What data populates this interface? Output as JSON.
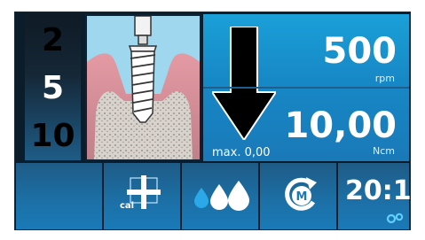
{
  "programs": {
    "items": [
      "2",
      "5",
      "10"
    ],
    "selected": "5"
  },
  "speed": {
    "value": "500",
    "unit": "rpm"
  },
  "torque": {
    "value": "10,00",
    "unit": "Ncm",
    "max_label": "max. 0,00"
  },
  "buttons": {
    "calibrate_label": "cal",
    "ratio_label": "20:1"
  },
  "colors": {
    "display_blue": "#1a8fcf",
    "button_blue": "#1c6fa5",
    "highlight_light_blue": "#9fd8ee",
    "background_dark": "#0b1c2b"
  }
}
